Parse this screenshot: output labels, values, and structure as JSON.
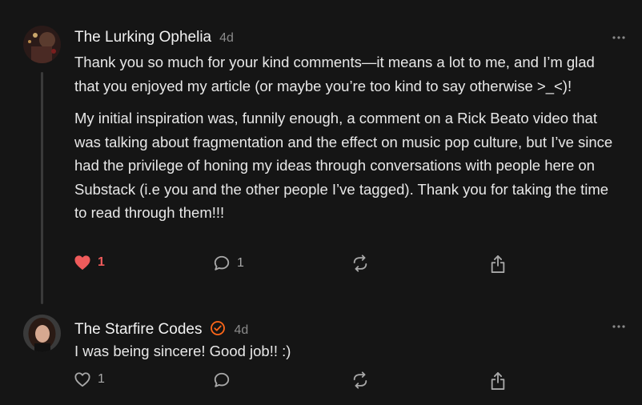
{
  "comments": [
    {
      "author": "The Lurking Ophelia",
      "time": "4d",
      "paragraphs": [
        "Thank you so much for your kind comments—it means a lot to me, and I’m glad that you enjoyed my article (or maybe you’re too kind to say otherwise >_<)!",
        "My initial inspiration was, funnily enough, a comment on a Rick Beato video that was talking about fragmentation and the effect on music pop culture, but I’ve since had the privilege of honing my ideas through conversations with people here on Substack (i.e you and the other people I’ve tagged). Thank you for taking the time to read through them!!!"
      ],
      "likes": "1",
      "replies": "1",
      "liked": true
    },
    {
      "author": "The Starfire Codes",
      "time": "4d",
      "verified": true,
      "paragraphs": [
        "I was being sincere! Good job!! :)"
      ],
      "likes": "1",
      "replies": "",
      "liked": false
    }
  ],
  "icons": {
    "more": "more-horizontal-icon",
    "like": "heart-icon",
    "reply": "comment-bubble-icon",
    "restack": "restack-icon",
    "share": "share-icon"
  },
  "colors": {
    "like": "#ef5b5b",
    "verified": "#ff6719",
    "background": "#151515"
  }
}
